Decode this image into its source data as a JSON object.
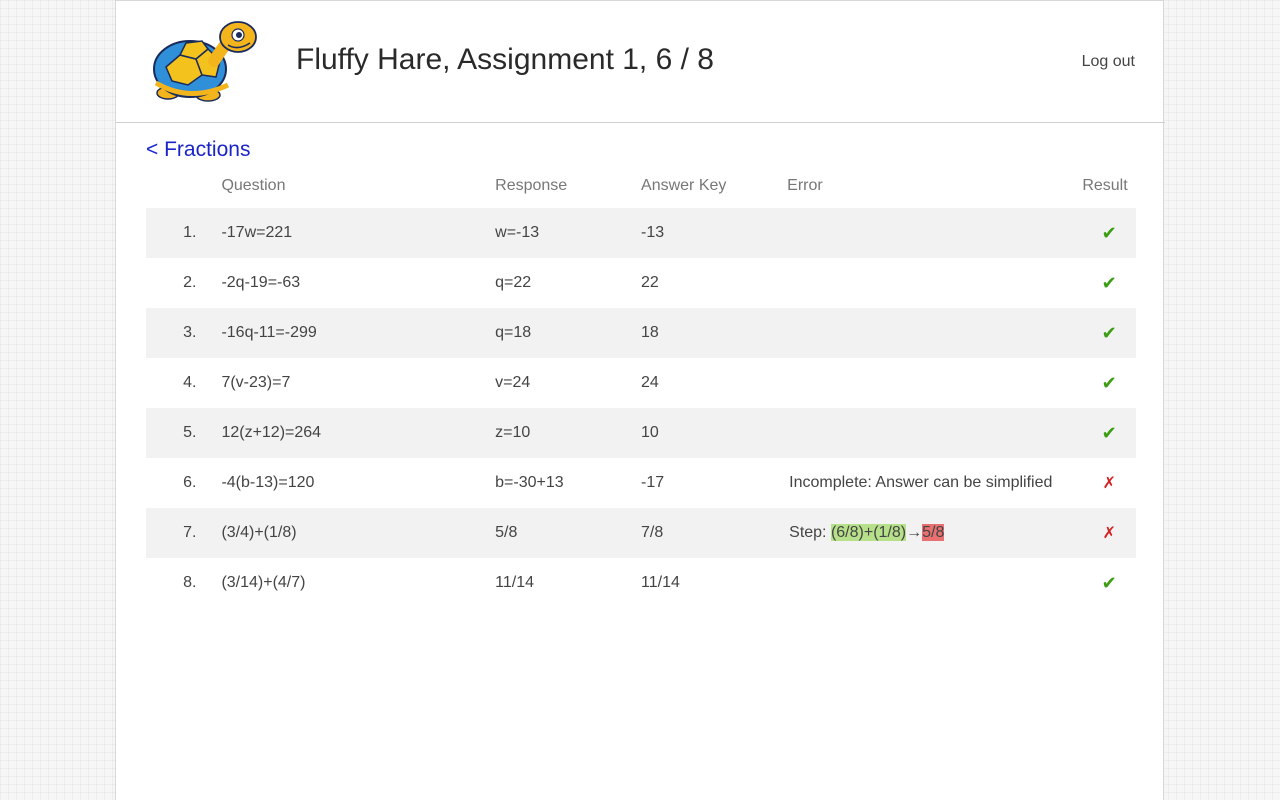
{
  "header": {
    "title": "Fluffy Hare, Assignment 1, 6 / 8",
    "logout_label": "Log out"
  },
  "nav": {
    "back_label": "< Fractions"
  },
  "table": {
    "headers": {
      "question": "Question",
      "response": "Response",
      "answer_key": "Answer Key",
      "error": "Error",
      "result": "Result"
    },
    "rows": [
      {
        "num": "1.",
        "question": "-17w=221",
        "response": "w=-13",
        "answer": "-13",
        "error": "",
        "result": "✔"
      },
      {
        "num": "2.",
        "question": "-2q-19=-63",
        "response": "q=22",
        "answer": "22",
        "error": "",
        "result": "✔"
      },
      {
        "num": "3.",
        "question": "-16q-11=-299",
        "response": "q=18",
        "answer": "18",
        "error": "",
        "result": "✔"
      },
      {
        "num": "4.",
        "question": "7(v-23)=7",
        "response": "v=24",
        "answer": "24",
        "error": "",
        "result": "✔"
      },
      {
        "num": "5.",
        "question": "12(z+12)=264",
        "response": "z=10",
        "answer": "10",
        "error": "",
        "result": "✔"
      },
      {
        "num": "6.",
        "question": "-4(b-13)=120",
        "response": "b=-30+13",
        "answer": "-17",
        "error": "Incomplete: Answer can be simplified",
        "result": "✗"
      },
      {
        "num": "7.",
        "question": "(3/4)+(1/8)",
        "response": "5/8",
        "answer": "7/8",
        "error_prefix": "Step: ",
        "error_from": "(6/8)+(1/8)",
        "error_arrow": "→",
        "error_to": "5/8",
        "result": "✗"
      },
      {
        "num": "8.",
        "question": "(3/14)+(4/7)",
        "response": "11/14",
        "answer": "11/14",
        "error": "",
        "result": "✔"
      }
    ]
  },
  "colors": {
    "correct": "#3a9d12",
    "incorrect": "#d42020",
    "link": "#1a24c9",
    "step_ok": "#b6e08a",
    "step_bad": "#e87070"
  },
  "icons": {
    "logo": "turtle-mascot-logo",
    "correct": "check-icon",
    "incorrect": "cross-icon"
  }
}
